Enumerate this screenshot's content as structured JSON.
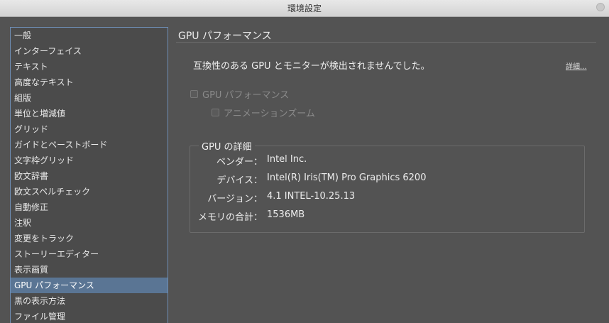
{
  "window": {
    "title": "環境設定"
  },
  "sidebar": {
    "items": [
      {
        "label": "一般"
      },
      {
        "label": "インターフェイス"
      },
      {
        "label": "テキスト"
      },
      {
        "label": "高度なテキスト"
      },
      {
        "label": "組版"
      },
      {
        "label": "単位と増減値"
      },
      {
        "label": "グリッド"
      },
      {
        "label": "ガイドとペーストボード"
      },
      {
        "label": "文字枠グリッド"
      },
      {
        "label": "欧文辞書"
      },
      {
        "label": "欧文スペルチェック"
      },
      {
        "label": "自動修正"
      },
      {
        "label": "注釈"
      },
      {
        "label": "変更をトラック"
      },
      {
        "label": "ストーリーエディター"
      },
      {
        "label": "表示画質"
      },
      {
        "label": "GPU パフォーマンス"
      },
      {
        "label": "黒の表示方法"
      },
      {
        "label": "ファイル管理"
      }
    ],
    "selected_index": 16
  },
  "main": {
    "section_title": "GPU パフォーマンス",
    "warning": "互換性のある GPU とモニターが検出されませんでした。",
    "details_link": "詳細...",
    "gpu_performance_checkbox": "GPU パフォーマンス",
    "animated_zoom_checkbox": "アニメーションズーム",
    "gpu_details": {
      "title": "GPU の詳細",
      "vendor_label": "ベンダー：",
      "vendor_value": "Intel Inc.",
      "device_label": "デバイス：",
      "device_value": "Intel(R) Iris(TM) Pro Graphics 6200",
      "version_label": "バージョン：",
      "version_value": "4.1 INTEL-10.25.13",
      "memory_label": "メモリの合計：",
      "memory_value": "1536MB"
    }
  }
}
